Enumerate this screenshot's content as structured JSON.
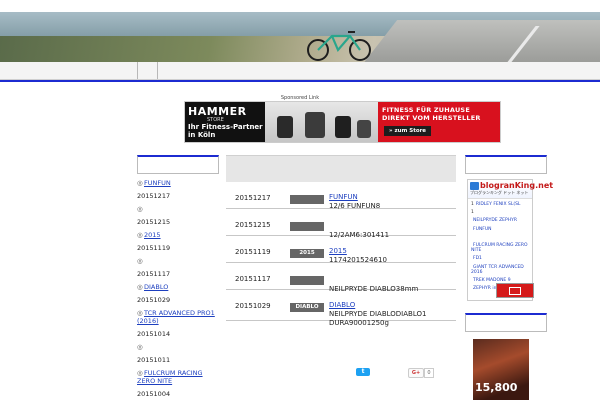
{
  "ad": {
    "sponsored_label": "Sponsored Link",
    "brand": "HAMMER",
    "brand_sub": "STORE",
    "tagline": "Ihr Fitness-Partner in Köln",
    "headline": "FITNESS FÜR ZUHAUSE DIREKT VOM HERSTELLER",
    "cta": "» zum Store"
  },
  "left_sidebar": {
    "items": [
      {
        "text": "FUNFUN",
        "link": true
      },
      {
        "text": "20151217",
        "link": false
      },
      {
        "text": "",
        "link": false
      },
      {
        "text": "20151215",
        "link": false
      },
      {
        "text": "2015",
        "link": true
      },
      {
        "text": "20151119",
        "link": false
      },
      {
        "text": "",
        "link": false
      },
      {
        "text": "20151117",
        "link": false
      },
      {
        "text": "DIABLO",
        "link": true
      },
      {
        "text": "20151029",
        "link": false
      },
      {
        "text": "TCR ADVANCED PRO1 (2016)",
        "link": true
      },
      {
        "text": "20151014",
        "link": false
      },
      {
        "text": "",
        "link": false
      },
      {
        "text": "20151011",
        "link": false
      },
      {
        "text": "FULCRUM RACING ZERO NITE",
        "link": true
      },
      {
        "text": "20151004",
        "link": false
      }
    ]
  },
  "entries": [
    {
      "date": "20151217",
      "tag": "",
      "title": "FUNFUN",
      "desc": "12/6 FUNFUN8"
    },
    {
      "date": "20151215",
      "tag": "",
      "title": "",
      "desc": "12/2AM6:301411"
    },
    {
      "date": "20151119",
      "tag": "2015",
      "title": "2015",
      "desc": "1174201524610"
    },
    {
      "date": "20151117",
      "tag": "",
      "title": "",
      "desc": "NEILPRYDE DIABLO38mm"
    },
    {
      "date": "20151029",
      "tag": "DIABLO",
      "title": "DIABLO",
      "desc": "NEILPRYDE DIABLODIABLO1 DURA90001250g"
    }
  ],
  "share": {
    "tweet": "t",
    "gplus": "G+",
    "gplus_count": "0"
  },
  "right_sidebar": {
    "rank_logo": "blogranKing.net",
    "rank_sub": "ブログランキング ドット ネット",
    "rank_items": [
      {
        "num": "1",
        "text": "RIDLEY FENIX SL(SL"
      },
      {
        "num": "1",
        "text": ""
      },
      {
        "num": "",
        "text": "NEILPRYDE ZEPHYR"
      },
      {
        "num": "",
        "text": "FUNFUN"
      },
      {
        "num": "",
        "text": ""
      },
      {
        "num": "",
        "text": "FULCRUM RACING ZERO NITE"
      },
      {
        "num": "",
        "text": "FD1"
      },
      {
        "num": "",
        "text": "GIANT TCR ADVANCED 2016"
      },
      {
        "num": "",
        "text": "TREK MADONE 9"
      },
      {
        "num": "",
        "text": "ZEPHYR in"
      }
    ],
    "promo_price": "15,800"
  },
  "colors": {
    "accent_blue": "#1c2bd1",
    "link_blue": "#1d3fbf",
    "tag_gray": "#666666",
    "ad_red": "#d8111e"
  }
}
